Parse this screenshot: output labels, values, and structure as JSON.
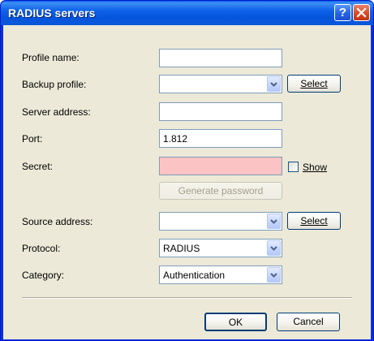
{
  "window": {
    "title": "RADIUS servers",
    "help_glyph": "?"
  },
  "form": {
    "profile_name_label": "Profile name:",
    "profile_name_value": "",
    "backup_profile_label": "Backup profile:",
    "backup_profile_value": "",
    "backup_select_label": "Select",
    "server_address_label": "Server address:",
    "server_address_value": "",
    "port_label": "Port:",
    "port_value": "1.812",
    "secret_label": "Secret:",
    "secret_value": "",
    "show_label": "Show",
    "show_checked": false,
    "generate_password_label": "Generate password",
    "source_address_label": "Source address:",
    "source_address_value": "",
    "source_select_label": "Select",
    "protocol_label": "Protocol:",
    "protocol_value": "RADIUS",
    "category_label": "Category:",
    "category_value": "Authentication"
  },
  "footer": {
    "ok_label": "OK",
    "cancel_label": "Cancel"
  },
  "colors": {
    "titlebar": "#0a5fe7",
    "client_bg": "#ece9d8",
    "secret_highlight": "#fbc3c3",
    "close_button": "#da4a25"
  }
}
